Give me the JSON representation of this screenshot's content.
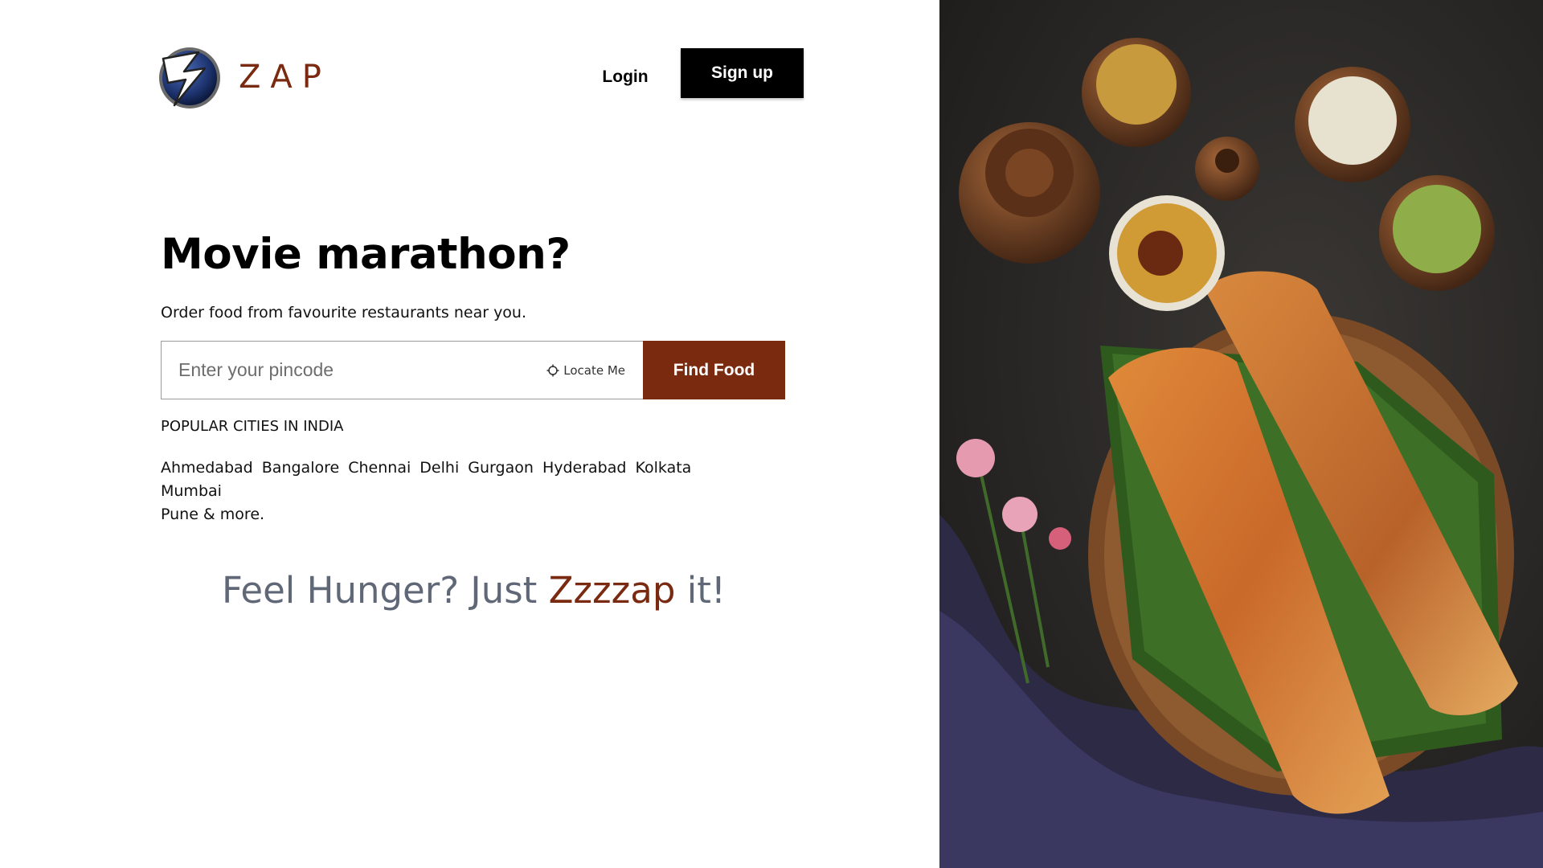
{
  "header": {
    "brand": "ZAP",
    "login_label": "Login",
    "signup_label": "Sign up"
  },
  "hero": {
    "title": "Movie marathon?",
    "subtitle": "Order food from favourite restaurants near you."
  },
  "search": {
    "placeholder": "Enter your pincode",
    "value": "",
    "locate_label": "Locate Me",
    "find_label": "Find Food"
  },
  "cities": {
    "heading": "POPULAR CITIES IN INDIA",
    "items": [
      "Ahmedabad",
      "Bangalore",
      "Chennai",
      "Delhi",
      "Gurgaon",
      "Hyderabad",
      "Kolkata",
      "Mumbai",
      "Pune & more."
    ]
  },
  "tagline": {
    "prefix": "Feel Hunger? Just ",
    "accent": "Zzzzap",
    "suffix": " it!"
  },
  "icons": {
    "logo": "lightning-bolt-logo",
    "locate": "crosshair-icon"
  },
  "colors": {
    "brand": "#7a2a10",
    "primary_button": "#7a2a0e",
    "signup_button": "#000000",
    "tagline_text": "#606878"
  }
}
